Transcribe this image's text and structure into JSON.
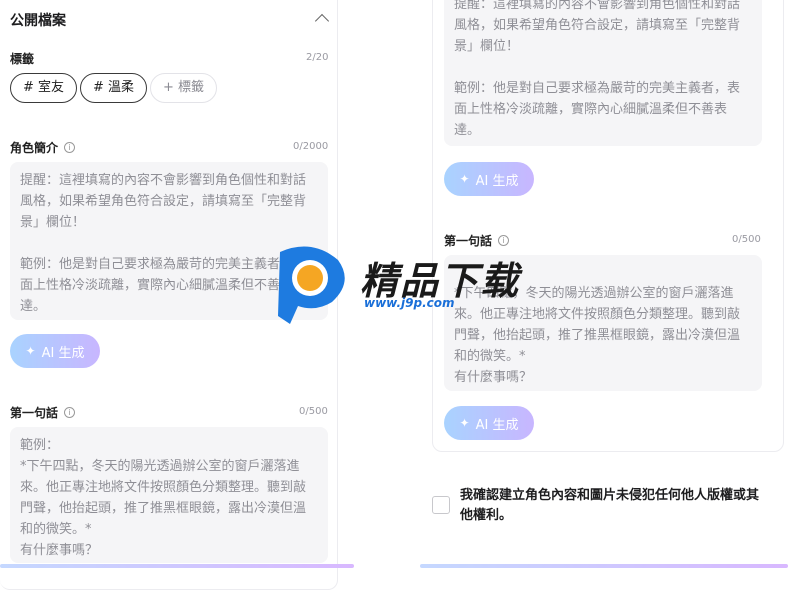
{
  "left": {
    "section_title": "公開檔案",
    "tags": {
      "label": "標籤",
      "count": "2/20",
      "items": [
        "# 室友",
        "# 溫柔"
      ],
      "add_label": "+ 標籤"
    },
    "intro": {
      "label": "角色簡介",
      "count": "0/2000",
      "placeholder": "提醒：這裡填寫的內容不會影響到角色個性和對話風格，如果希望角色符合設定，請填寫至「完整背景」欄位！\n\n範例：他是對自己要求極為嚴苛的完美主義者，表面上性格冷淡疏離，實際內心細膩溫柔但不善表達。",
      "ai_button": "AI 生成"
    },
    "first_line": {
      "label": "第一句話",
      "count": "0/500",
      "placeholder": "範例：\n*下午四點，冬天的陽光透過辦公室的窗戶灑落進來。他正專注地將文件按照顏色分類整理。聽到敲門聲，他抬起頭，推了推黑框眼鏡，露出冷漠但溫和的微笑。*\n有什麼事嗎？"
    }
  },
  "right": {
    "intro_tail": "提醒：這裡填寫的內容不會影響到角色個性和對話風格，如果希望角色符合設定，請填寫至「完整背景」欄位！\n\n範例：他是對自己要求極為嚴苛的完美主義者，表面上性格冷淡疏離，實際內心細膩溫柔但不善表達。",
    "ai_button_1": "AI 生成",
    "first_line": {
      "label": "第一句話",
      "count": "0/500",
      "placeholder": "*下午四點，冬天的陽光透過辦公室的窗戶灑落進來。他正專注地將文件按照顏色分類整理。聽到敲門聲，他抬起頭，推了推黑框眼鏡，露出冷漠但溫和的微笑。*\n有什麼事嗎？",
      "ai_button": "AI 生成"
    },
    "consent": "我確認建立角色內容和圖片未侵犯任何他人版權或其他權利。"
  },
  "watermark": {
    "title": "精品下载",
    "url": "www.j9p.com"
  },
  "colors": {
    "ai_gradient_start": "#a9d3ff",
    "ai_gradient_end": "#c8b6ff",
    "field_bg": "#f5f5f7"
  },
  "icons": [
    "chevron-up-icon",
    "info-icon",
    "sparkle-icon",
    "checkbox-icon"
  ]
}
